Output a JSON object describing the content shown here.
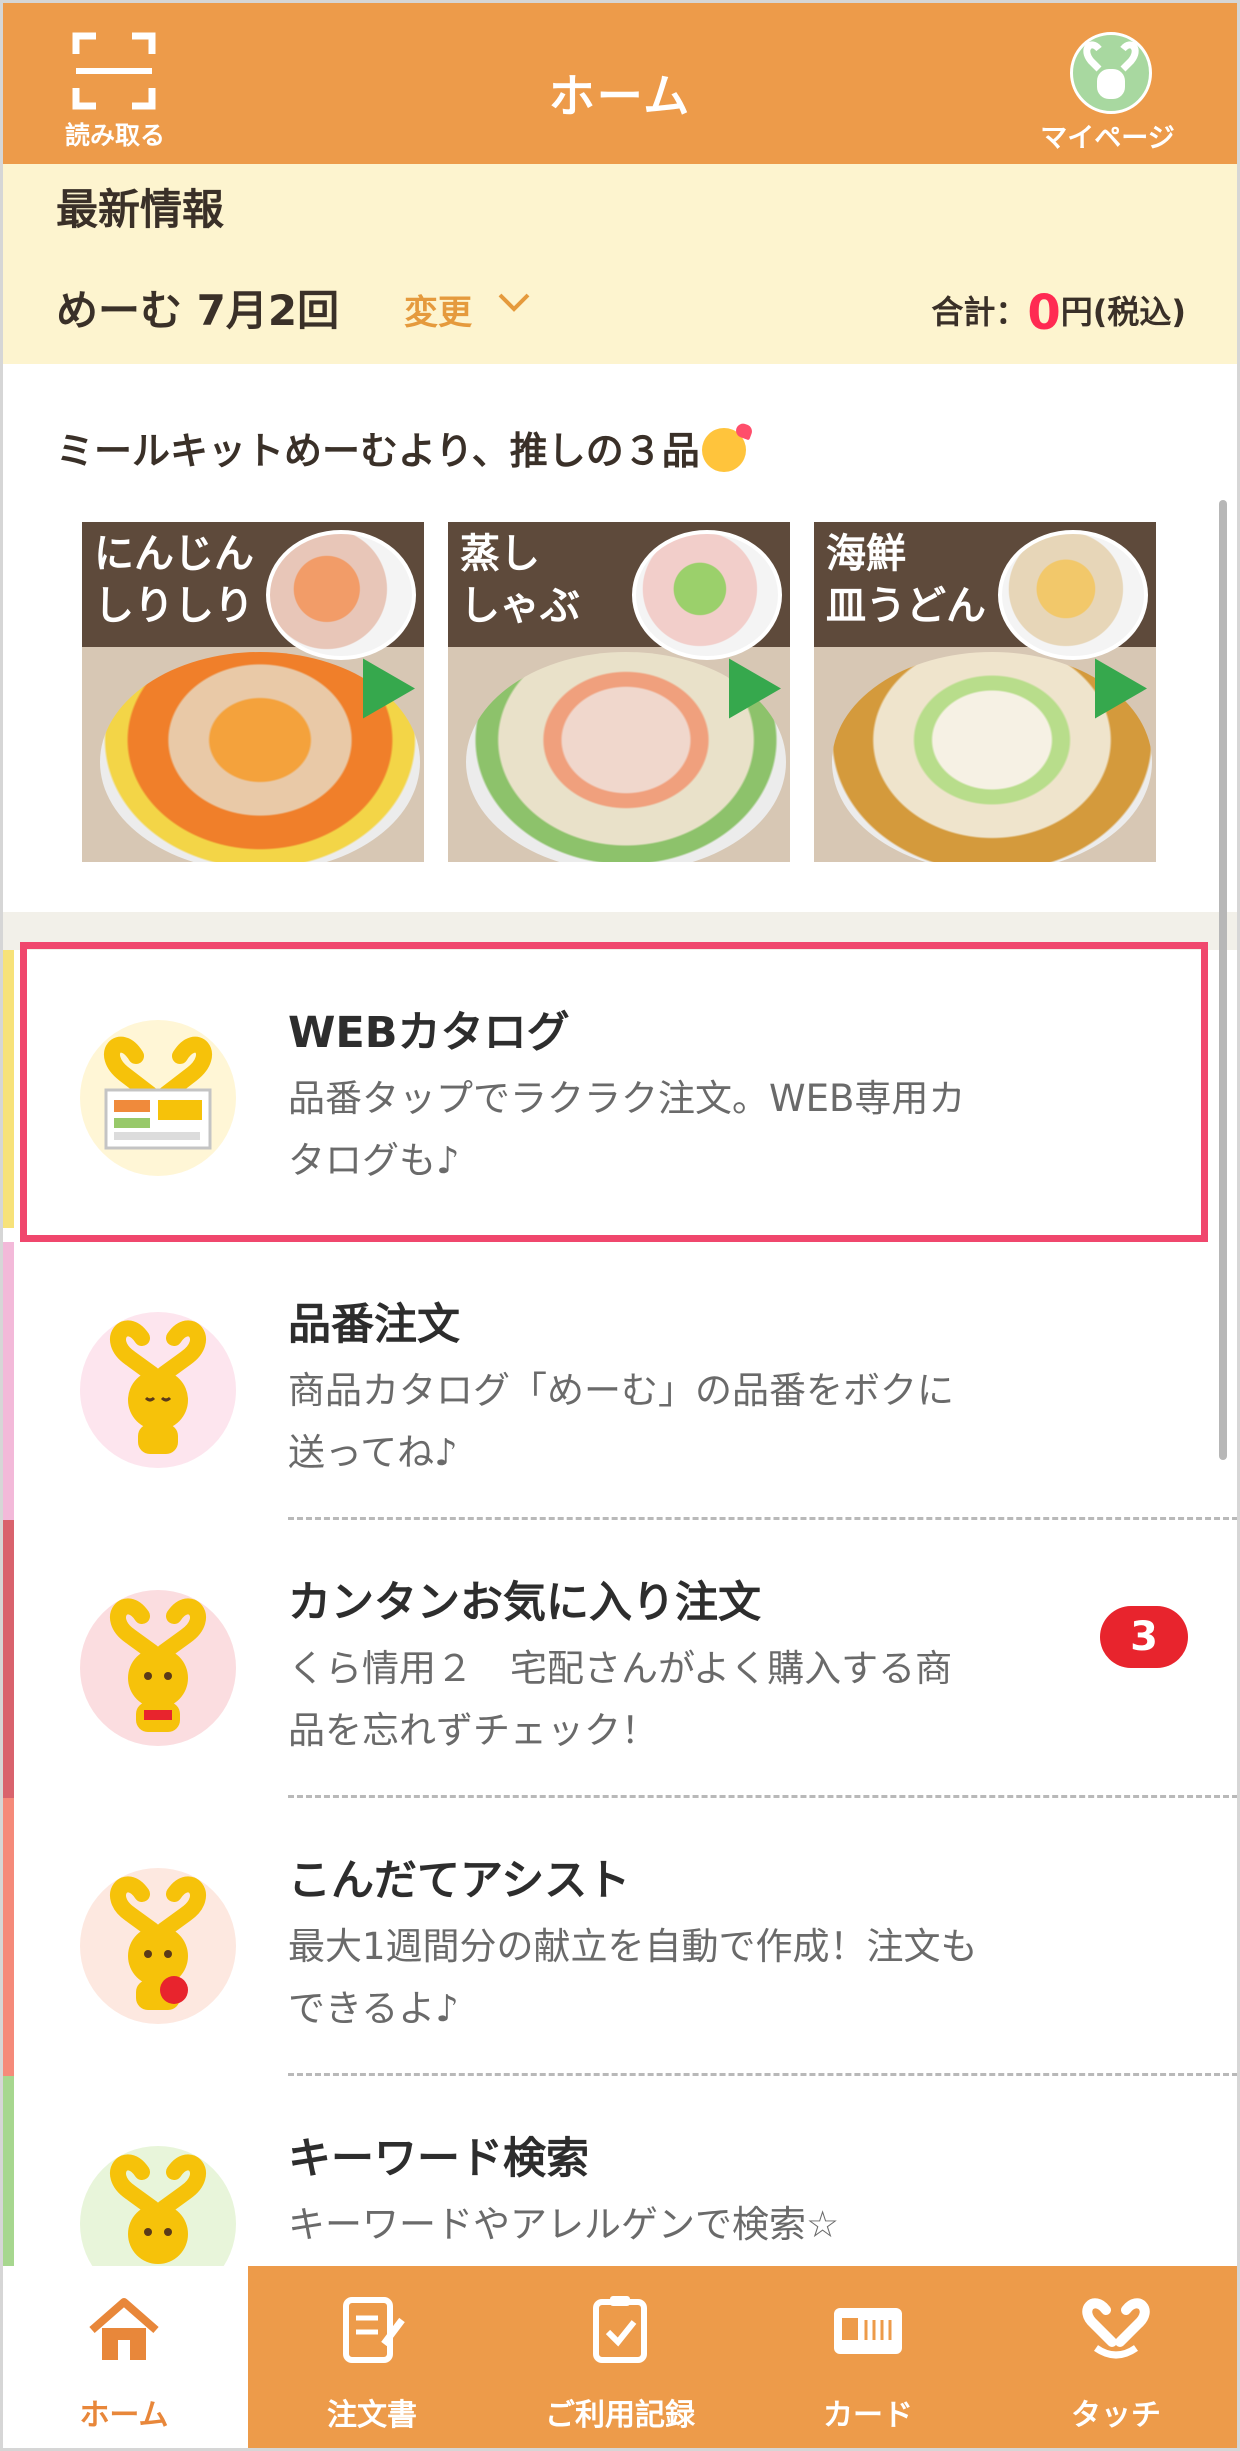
{
  "header": {
    "title": "ホーム",
    "scan_label": "読み取る",
    "mypage_label": "マイページ"
  },
  "info": {
    "title": "最新情報",
    "issue": "めーむ 7月2回",
    "change_label": "変更",
    "total_prefix": "合計：",
    "total_value": "0",
    "total_suffix": "円(税込)"
  },
  "recommend": {
    "title": "ミールキットめーむより、推しの３品",
    "items": [
      {
        "name": "にんじん\nしりしり"
      },
      {
        "name": "蒸し\nしゃぶ"
      },
      {
        "name": "海鮮\n皿うどん"
      }
    ]
  },
  "menu": [
    {
      "title": "WEBカタログ",
      "desc": "品番タップでラクラク注文。WEB専用カタログも♪",
      "icon": "web-catalog-icon",
      "stripe": "#f7e27a"
    },
    {
      "title": "品番注文",
      "desc": "商品カタログ「めーむ」の品番をボクに送ってね♪",
      "icon": "mascot-icon",
      "stripe": "#f3b9d9"
    },
    {
      "title": "カンタンお気に入り注文",
      "desc": "くら情用２　宅配さんがよく購入する商品を忘れずチェック！",
      "icon": "mascot-icon",
      "stripe": "#d9636d",
      "badge": "3"
    },
    {
      "title": "こんだてアシスト",
      "desc": "最大1週間分の献立を自動で作成！注文もできるよ♪",
      "icon": "mascot-icon",
      "stripe": "#f58a7a"
    },
    {
      "title": "キーワード検索",
      "desc": "キーワードやアレルゲンで検索☆",
      "icon": "mascot-icon",
      "stripe": "#a7d78f"
    }
  ],
  "bottom_nav": [
    {
      "label": "ホーム",
      "icon": "home-icon",
      "active": true
    },
    {
      "label": "注文書",
      "icon": "order-form-icon"
    },
    {
      "label": "ご利用記録",
      "icon": "history-icon"
    },
    {
      "label": "カード",
      "icon": "card-icon"
    },
    {
      "label": "タッチ",
      "icon": "touch-icon"
    }
  ],
  "colors": {
    "brand_orange": "#ed9b4a",
    "info_yellow": "#fdf4cf",
    "price_red": "#ff2a52",
    "highlight_pink": "#f0476d",
    "badge_red": "#e8242d"
  }
}
